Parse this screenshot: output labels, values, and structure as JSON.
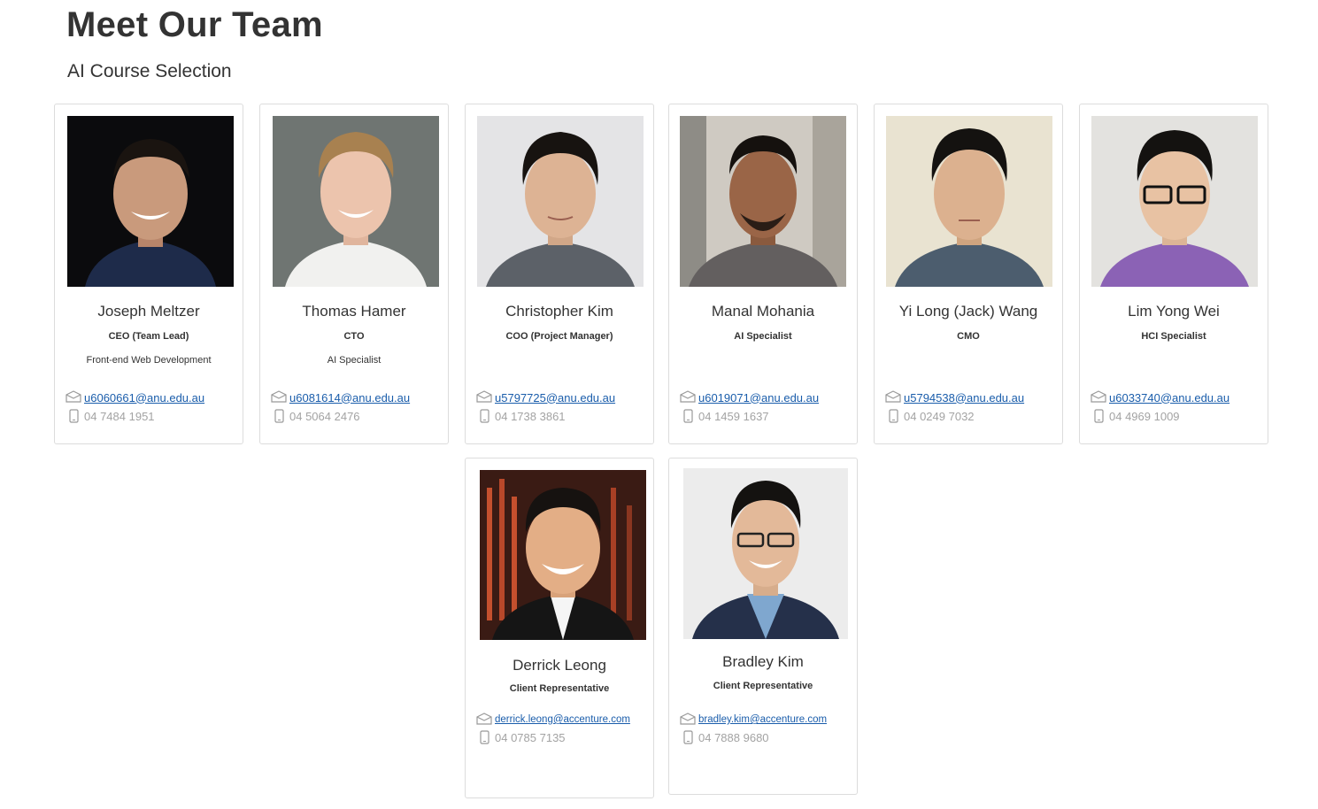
{
  "header": {
    "title": "Meet Our Team",
    "subtitle": "AI Course Selection"
  },
  "members": [
    {
      "name": "Joseph Meltzer",
      "role": "CEO (Team Lead)",
      "desc": "Front-end Web Development",
      "email": "u6060661@anu.edu.au",
      "phone": "04 7484 1951",
      "icon_email": "envelope-icon",
      "icon_phone": "mobile-phone-icon"
    },
    {
      "name": "Thomas Hamer",
      "role": "CTO",
      "desc": "AI Specialist",
      "email": "u6081614@anu.edu.au",
      "phone": "04 5064 2476",
      "icon_email": "envelope-icon",
      "icon_phone": "mobile-phone-icon"
    },
    {
      "name": "Christopher Kim",
      "role": "COO (Project Manager)",
      "desc": "",
      "email": "u5797725@anu.edu.au",
      "phone": "04 1738 3861",
      "icon_email": "envelope-icon",
      "icon_phone": "mobile-phone-icon"
    },
    {
      "name": "Manal Mohania",
      "role": "AI Specialist",
      "desc": "",
      "email": "u6019071@anu.edu.au",
      "phone": "04 1459 1637",
      "icon_email": "envelope-icon",
      "icon_phone": "mobile-phone-icon"
    },
    {
      "name": "Yi Long (Jack) Wang",
      "role": "CMO",
      "desc": "",
      "email": "u5794538@anu.edu.au",
      "phone": "04 0249 7032",
      "icon_email": "envelope-icon",
      "icon_phone": "mobile-phone-icon"
    },
    {
      "name": "Lim Yong Wei",
      "role": "HCI Specialist",
      "desc": "",
      "email": "u6033740@anu.edu.au",
      "phone": "04 4969 1009",
      "icon_email": "envelope-icon",
      "icon_phone": "mobile-phone-icon"
    },
    {
      "name": "Derrick Leong",
      "role": "Client Representative",
      "desc": "",
      "email": "derrick.leong@accenture.com",
      "phone": "04 0785 7135",
      "icon_email": "envelope-icon",
      "icon_phone": "mobile-phone-icon"
    },
    {
      "name": "Bradley Kim",
      "role": "Client Representative",
      "desc": "",
      "email": "bradley.kim@accenture.com",
      "phone": "04 7888 9680",
      "icon_email": "envelope-icon",
      "icon_phone": "mobile-phone-icon"
    }
  ],
  "colors": {
    "link": "#1a5dab",
    "muted": "#a3a3a3",
    "border": "#dcdcdc",
    "text": "#333333"
  }
}
